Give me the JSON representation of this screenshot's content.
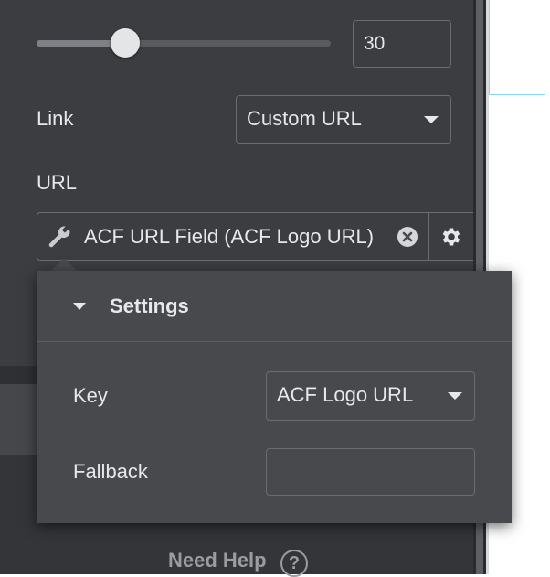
{
  "slider": {
    "value": 30,
    "min": 0,
    "max": 100,
    "display": "30",
    "fill_fraction": 0.3
  },
  "link": {
    "label": "Link",
    "selected": "Custom URL"
  },
  "url": {
    "label": "URL",
    "dynamic_tag": "ACF URL Field (ACF Logo URL)"
  },
  "settings_popover": {
    "title": "Settings",
    "key_label": "Key",
    "key_selected": "ACF Logo URL",
    "fallback_label": "Fallback",
    "fallback_value": ""
  },
  "footer": {
    "need_help": "Need Help",
    "help_glyph": "?"
  },
  "colors": {
    "panel_bg": "#3c3d41",
    "popover_bg": "#48494d",
    "border": "#6a6c70",
    "text": "#e6e8ea",
    "canvas_outline": "#8fd6f0"
  },
  "icons": [
    "wrench-icon",
    "clear-circle-icon",
    "gear-icon",
    "caret-down-icon",
    "help-circle-icon"
  ]
}
